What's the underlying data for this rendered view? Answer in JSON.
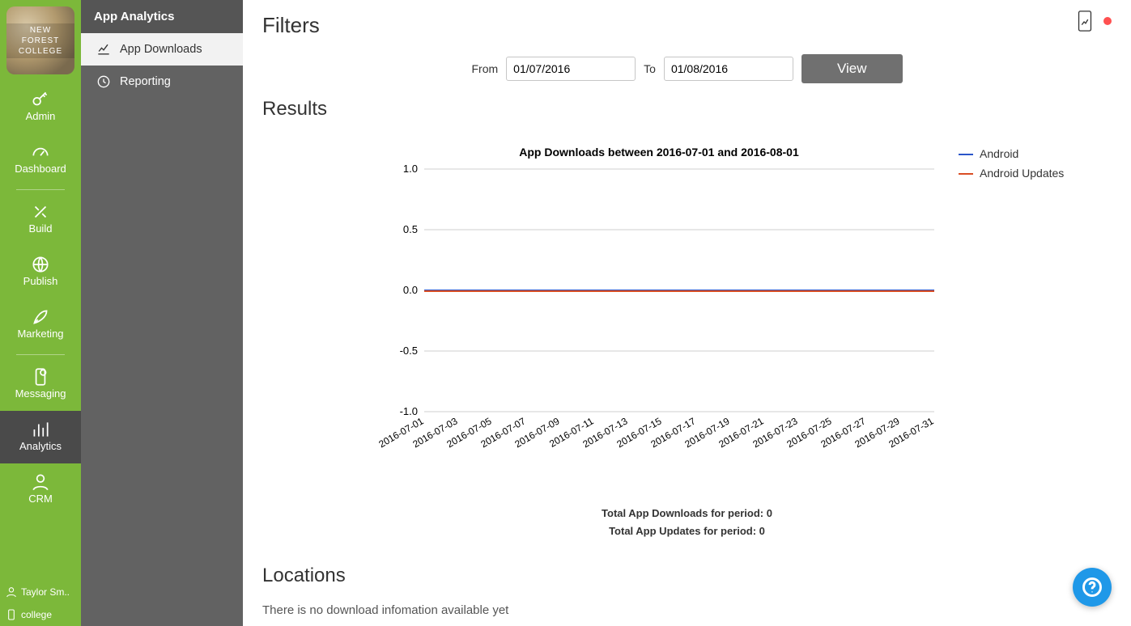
{
  "brand": "NEW FOREST COLLEGE",
  "rail": {
    "items": [
      {
        "label": "Admin"
      },
      {
        "label": "Dashboard"
      },
      {
        "label": "Build"
      },
      {
        "label": "Publish"
      },
      {
        "label": "Marketing"
      },
      {
        "label": "Messaging"
      },
      {
        "label": "Analytics",
        "active": true
      },
      {
        "label": "CRM"
      }
    ],
    "user": "Taylor Sm..",
    "app": "college"
  },
  "subnav": {
    "title": "App Analytics",
    "items": [
      {
        "label": "App Downloads",
        "active": true
      },
      {
        "label": "Reporting"
      }
    ]
  },
  "headings": {
    "filters": "Filters",
    "results": "Results",
    "locations": "Locations"
  },
  "filters": {
    "from_label": "From",
    "to_label": "To",
    "from_value": "01/07/2016",
    "to_value": "01/08/2016",
    "view_label": "View"
  },
  "chart_data": {
    "type": "line",
    "title": "App Downloads between 2016-07-01 and 2016-08-01",
    "xlabel": "",
    "ylabel": "",
    "ylim": [
      -1.0,
      1.0
    ],
    "yticks": [
      -1.0,
      -0.5,
      0.0,
      0.5,
      1.0
    ],
    "categories": [
      "2016-07-01",
      "2016-07-03",
      "2016-07-05",
      "2016-07-07",
      "2016-07-09",
      "2016-07-11",
      "2016-07-13",
      "2016-07-15",
      "2016-07-17",
      "2016-07-19",
      "2016-07-21",
      "2016-07-23",
      "2016-07-25",
      "2016-07-27",
      "2016-07-29",
      "2016-07-31"
    ],
    "series": [
      {
        "name": "Android",
        "color": "#2a55c9",
        "values": [
          0,
          0,
          0,
          0,
          0,
          0,
          0,
          0,
          0,
          0,
          0,
          0,
          0,
          0,
          0,
          0
        ]
      },
      {
        "name": "Android Updates",
        "color": "#d94e24",
        "values": [
          0,
          0,
          0,
          0,
          0,
          0,
          0,
          0,
          0,
          0,
          0,
          0,
          0,
          0,
          0,
          0
        ]
      }
    ]
  },
  "totals": {
    "downloads": "Total App Downloads for period: 0",
    "updates": "Total App Updates for period: 0"
  },
  "locations_empty": "There is no download infomation available yet"
}
